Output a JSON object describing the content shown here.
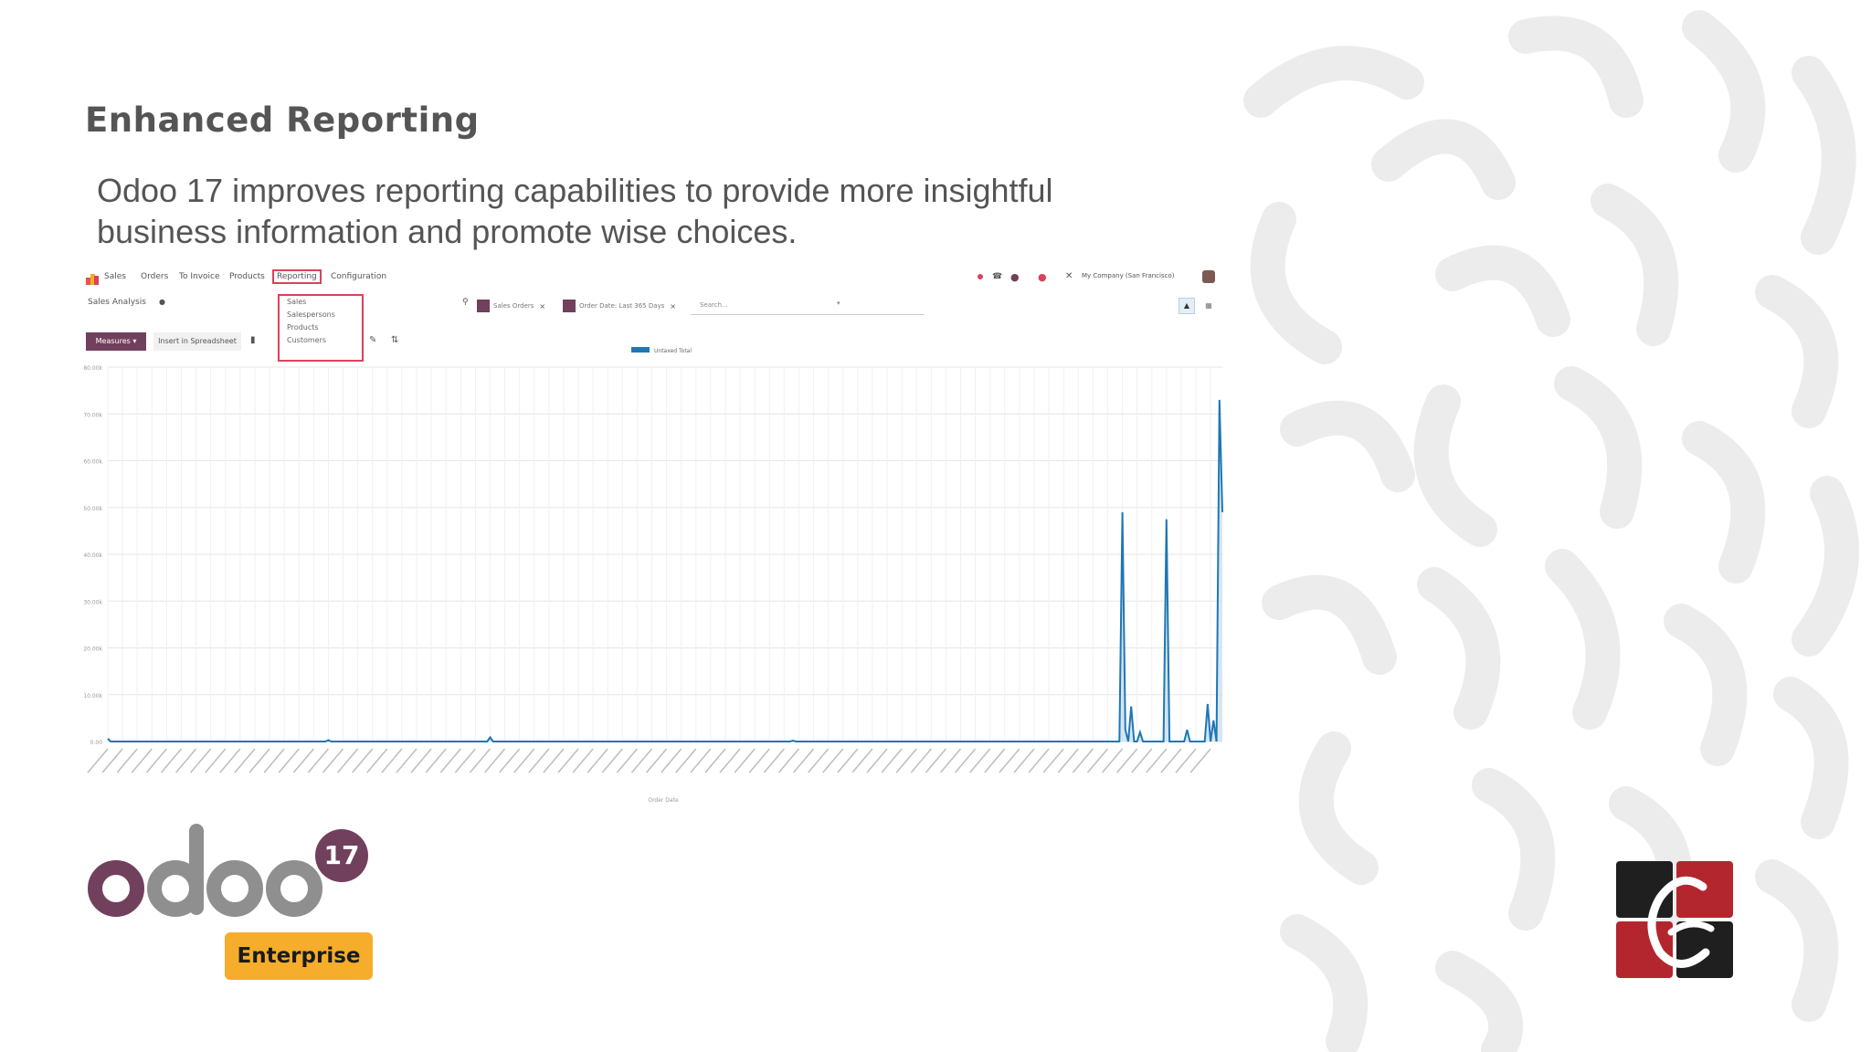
{
  "slide": {
    "heading": "Enhanced Reporting",
    "subtitle_line1": "Odoo 17 improves reporting capabilities to provide more insightful",
    "subtitle_line2": "business information and promote wise choices."
  },
  "app": {
    "app_name": "Sales",
    "menu": [
      "Orders",
      "To Invoice",
      "Products",
      "Reporting",
      "Configuration"
    ],
    "active_menu": "Reporting",
    "company": "My Company (San Francisco)",
    "breadcrumb": "Sales Analysis",
    "reporting_menu_items": [
      "Sales",
      "Salespersons",
      "Products",
      "Customers"
    ],
    "filters": [
      "Sales Orders",
      "Order Date: Last 365 Days"
    ],
    "search_placeholder": "Search...",
    "measures_label": "Measures ▾",
    "insert_label": "Insert in Spreadsheet"
  },
  "chart_data": {
    "type": "line",
    "series": [
      {
        "name": "Untaxed Total"
      }
    ],
    "xlabel": "Order Date",
    "ylabel": "",
    "yticks": [
      "0.00",
      "10.00k",
      "20.00k",
      "30.00k",
      "40.00k",
      "50.00k",
      "60.00k",
      "70.00k",
      "80.00k"
    ],
    "ylim": [
      0,
      80000
    ],
    "x_points": 380,
    "values_sparse": [
      {
        "i": 0,
        "v": 600
      },
      {
        "i": 75,
        "v": 300
      },
      {
        "i": 130,
        "v": 900
      },
      {
        "i": 233,
        "v": 200
      },
      {
        "i": 345,
        "v": 49000
      },
      {
        "i": 346,
        "v": 2500
      },
      {
        "i": 348,
        "v": 7500
      },
      {
        "i": 351,
        "v": 2000
      },
      {
        "i": 360,
        "v": 47500
      },
      {
        "i": 367,
        "v": 2500
      },
      {
        "i": 374,
        "v": 8000
      },
      {
        "i": 376,
        "v": 4500
      },
      {
        "i": 378,
        "v": 73000
      },
      {
        "i": 379,
        "v": 49000
      }
    ],
    "grid": true,
    "legend": "top-center",
    "colors": {
      "line": "#1f77b4",
      "fill": "#c6dcee"
    }
  },
  "brand": {
    "logo_text": "odoo",
    "version_badge": "17",
    "edition": "Enterprise",
    "colors": {
      "purple": "#71405d",
      "gray": "#8f8f8f",
      "gold": "#f6ad2b",
      "red": "#b3262e"
    }
  }
}
